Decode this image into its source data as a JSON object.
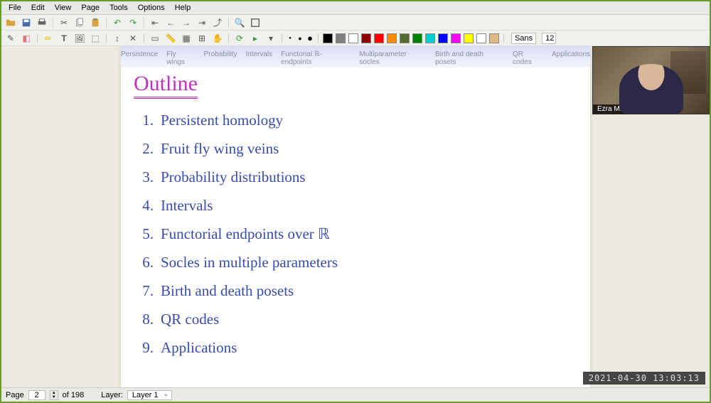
{
  "menubar": [
    "File",
    "Edit",
    "View",
    "Page",
    "Tools",
    "Options",
    "Help"
  ],
  "toolbar1_icons": [
    "open-icon",
    "save-icon",
    "print-icon",
    "cut-icon",
    "copy-icon",
    "paste-icon",
    "undo-icon",
    "redo-icon",
    "first-icon",
    "prev-icon",
    "next-icon",
    "last-icon",
    "zoomout-icon",
    "zoomin-icon",
    "search-icon",
    "fullscreen-icon"
  ],
  "toolbar2_icons": [
    "pen-icon",
    "eraser-icon",
    "highlighter-icon",
    "text-icon",
    "image-icon",
    "shapes-icon",
    "insert-icon",
    "ruler-icon",
    "grid-icon",
    "snap-icon",
    "layers-icon",
    "rotate-icon",
    "refresh-icon",
    "play-icon",
    "dropdown-icon"
  ],
  "dot_sizes": [
    "•",
    "●",
    "⬤"
  ],
  "swatches": [
    "#000000",
    "#808080",
    "#ffffff",
    "#8b0000",
    "#ff0000",
    "#ff8c00",
    "#556b2f",
    "#008000",
    "#00ced1",
    "#0000ff",
    "#ff00ff",
    "#ffff00",
    "#ffffff",
    "#deb887"
  ],
  "font": {
    "name": "Sans",
    "size": "12"
  },
  "slide_nav": [
    "Persistence",
    "Fly wings",
    "Probability",
    "Intervals",
    "Functorial ℝ-endpoints",
    "Multiparameter socles",
    "Birth and death posets",
    "QR codes",
    "Applications"
  ],
  "slide": {
    "title": "Outline",
    "items": [
      "Persistent homology",
      "Fruit fly wing veins",
      "Probability distributions",
      "Intervals",
      "Functorial endpoints over ℝ",
      "Socles in multiple parameters",
      "Birth and death posets",
      "QR codes",
      "Applications"
    ]
  },
  "webcam": {
    "label": "Ezra Miller"
  },
  "timestamp": "2021-04-30  13:03:13",
  "status": {
    "page_label": "Page",
    "page_current": "2",
    "page_of": "of 198",
    "layer_label": "Layer:",
    "layer_value": "Layer 1"
  }
}
